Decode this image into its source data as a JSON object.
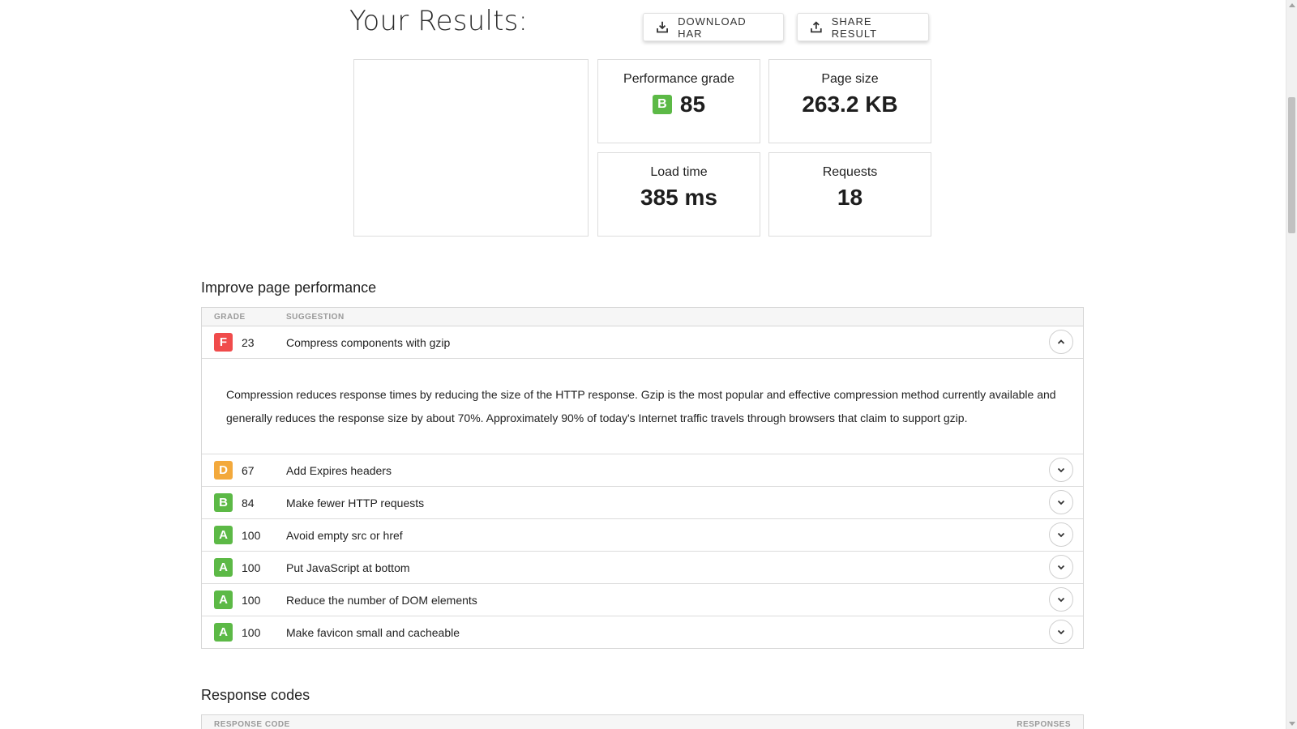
{
  "header": {
    "title": "Your Results:",
    "download_label": "DOWNLOAD HAR",
    "share_label": "SHARE RESULT"
  },
  "summary": {
    "grade": {
      "label": "Performance grade",
      "letter": "B",
      "value": "85"
    },
    "page_size": {
      "label": "Page size",
      "value": "263.2 KB"
    },
    "load_time": {
      "label": "Load time",
      "value": "385 ms"
    },
    "requests": {
      "label": "Requests",
      "value": "18"
    }
  },
  "improve": {
    "title": "Improve page performance",
    "col_grade": "GRADE",
    "col_suggestion": "SUGGESTION",
    "rows": [
      {
        "letter": "F",
        "score": "23",
        "text": "Compress components with gzip",
        "expanded": true,
        "description": "Compression reduces response times by reducing the size of the HTTP response. Gzip is the most popular and effective compression method currently available and generally reduces the response size by about 70%. Approximately 90% of today's Internet traffic travels through browsers that claim to support gzip."
      },
      {
        "letter": "D",
        "score": "67",
        "text": "Add Expires headers",
        "expanded": false
      },
      {
        "letter": "B",
        "score": "84",
        "text": "Make fewer HTTP requests",
        "expanded": false
      },
      {
        "letter": "A",
        "score": "100",
        "text": "Avoid empty src or href",
        "expanded": false
      },
      {
        "letter": "A",
        "score": "100",
        "text": "Put JavaScript at bottom",
        "expanded": false
      },
      {
        "letter": "A",
        "score": "100",
        "text": "Reduce the number of DOM elements",
        "expanded": false
      },
      {
        "letter": "A",
        "score": "100",
        "text": "Make favicon small and cacheable",
        "expanded": false
      }
    ]
  },
  "responses": {
    "title": "Response codes",
    "col_code": "RESPONSE CODE",
    "col_responses": "RESPONSES"
  },
  "colors": {
    "grade_A": "#5cb946",
    "grade_B": "#5cb946",
    "grade_D": "#f3a93c",
    "grade_F": "#f04b4b"
  },
  "icons": {
    "download": "download-icon",
    "share": "upload-share-icon",
    "collapse": "chevron-up-icon",
    "expand": "chevron-down-icon"
  }
}
